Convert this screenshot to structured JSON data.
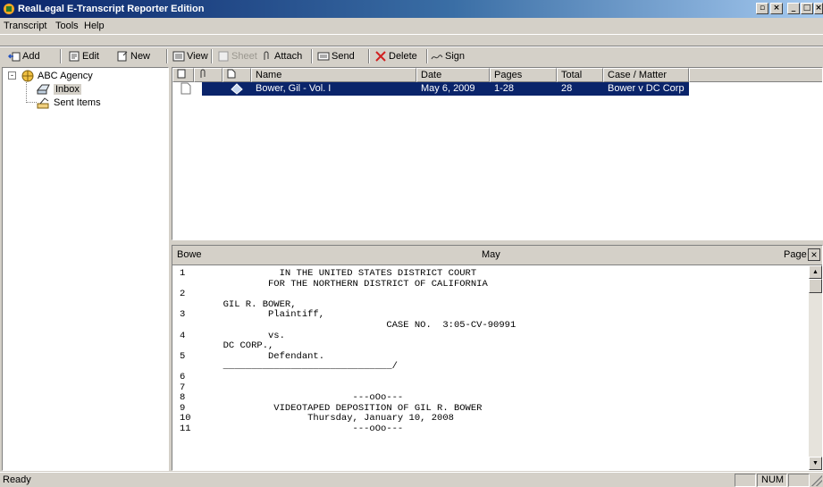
{
  "window": {
    "title": "RealLegal E-Transcript Reporter Edition"
  },
  "menu": {
    "items": [
      "Transcript",
      "Tools",
      "Help"
    ]
  },
  "toolbar": {
    "add": "Add",
    "edit": "Edit",
    "new": "New",
    "view": "View",
    "sheet": "Sheet",
    "attach": "Attach",
    "send": "Send",
    "delete": "Delete",
    "sign": "Sign"
  },
  "tree": {
    "root": "ABC Agency",
    "inbox": "Inbox",
    "sent": "Sent Items"
  },
  "list": {
    "columns": [
      "Name",
      "Date",
      "Pages",
      "Total",
      "Case / Matter"
    ],
    "rows": [
      {
        "name": "Bower, Gil - Vol. I",
        "date": "May 6, 2009",
        "pages": "1-28",
        "total": "28",
        "case": "Bower v DC Corp"
      }
    ]
  },
  "viewer": {
    "header_left": "Bowe",
    "header_mid": "May",
    "header_right": "Page",
    "lines": [
      {
        "num": "1",
        "text": "            IN THE UNITED STATES DISTRICT COURT"
      },
      {
        "num": "",
        "text": "          FOR THE NORTHERN DISTRICT OF CALIFORNIA"
      },
      {
        "num": "2",
        "text": ""
      },
      {
        "num": "",
        "text": "  GIL R. BOWER,"
      },
      {
        "num": "3",
        "text": "          Plaintiff,"
      },
      {
        "num": "",
        "text": "                               CASE NO.  3:05-CV-90991"
      },
      {
        "num": "4",
        "text": "          vs."
      },
      {
        "num": "",
        "text": "  DC CORP.,"
      },
      {
        "num": "5",
        "text": "          Defendant."
      },
      {
        "num": "",
        "text": "  ______________________________/"
      },
      {
        "num": "6",
        "text": ""
      },
      {
        "num": "7",
        "text": ""
      },
      {
        "num": "8",
        "text": "                         ---oOo---"
      },
      {
        "num": "9",
        "text": "           VIDEOTAPED DEPOSITION OF GIL R. BOWER"
      },
      {
        "num": "10",
        "text": "                 Thursday, January 10, 2008"
      },
      {
        "num": "11",
        "text": "                         ---oOo---"
      }
    ]
  },
  "status": {
    "text": "Ready",
    "num": "NUM"
  }
}
